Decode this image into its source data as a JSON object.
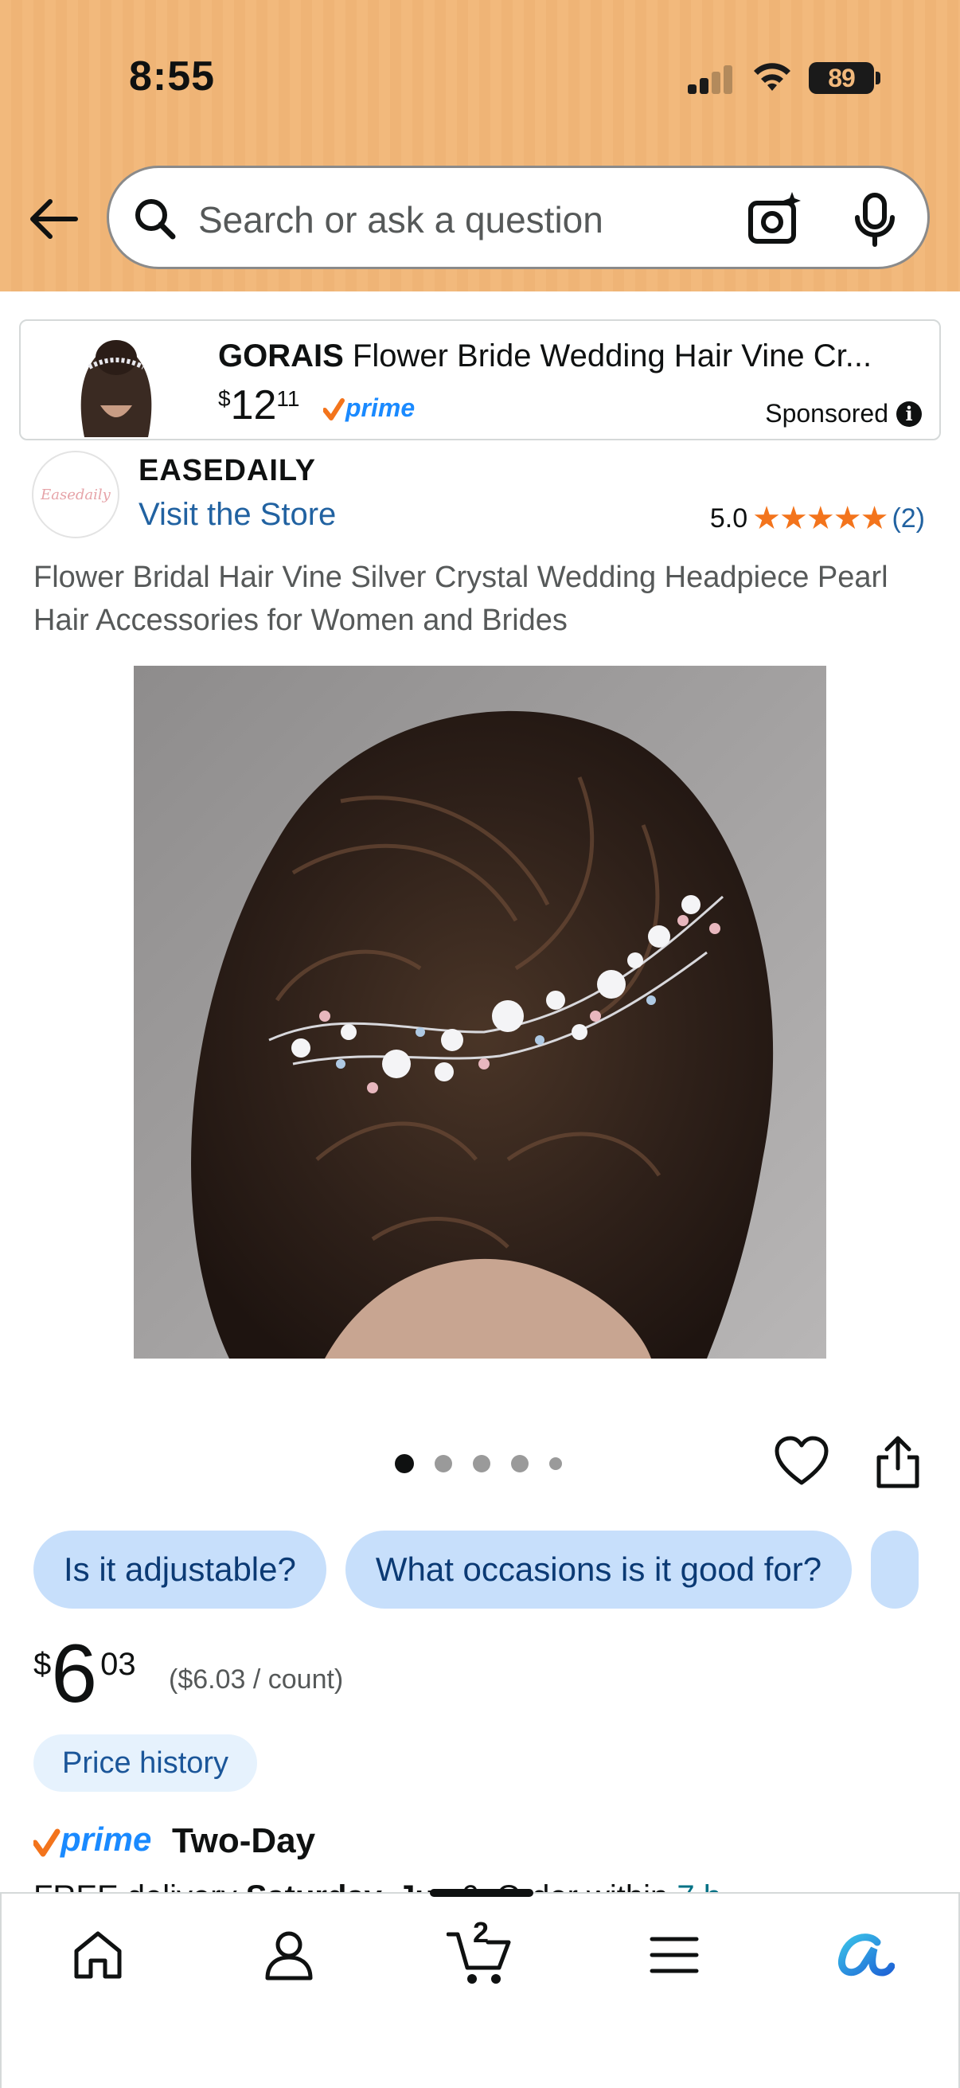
{
  "status_bar": {
    "time": "8:55",
    "battery": "89"
  },
  "search": {
    "placeholder": "Search or ask a question"
  },
  "sponsored_ad": {
    "brand": "GORAIS",
    "title": "Flower Bride Wedding Hair Vine Cr...",
    "price_currency": "$",
    "price_whole": "12",
    "price_fraction": "11",
    "label": "Sponsored"
  },
  "store": {
    "logo_text": "Easedaily",
    "brand_name": "EASEDAILY",
    "visit_store": "Visit the Store",
    "rating_value": "5.0",
    "rating_stars": 5,
    "rating_count": "(2)"
  },
  "product": {
    "title": "Flower Bridal Hair Vine Silver Crystal Wedding Headpiece Pearl Hair Accessories for Women and Brides",
    "image_count": 5,
    "active_image": 1
  },
  "question_chips": [
    "Is it adjustable?",
    "What occasions is it good for?"
  ],
  "price": {
    "currency": "$",
    "whole": "6",
    "fraction": "03",
    "unit_price": "($6.03 / count)"
  },
  "price_history_label": "Price history",
  "delivery": {
    "prime_label": "prime",
    "speed": "Two-Day",
    "cut_text_prefix": "FREE delivery ",
    "cut_text_bold": "Saturday, Ju",
    "cut_text_suffix": " . 6. Order within ",
    "cut_text_teal": "7 h"
  },
  "bottom_nav": {
    "cart_count": "2",
    "items": [
      "home-icon",
      "account-icon",
      "cart-icon",
      "menu-icon",
      "rufus-icon"
    ]
  },
  "colors": {
    "header_bg": "#f2b97c",
    "link": "#2162a1",
    "star": "#f3741c",
    "chip_bg": "#c7dffb",
    "prime_blue": "#1a8aff",
    "prime_check": "#f3741c"
  }
}
